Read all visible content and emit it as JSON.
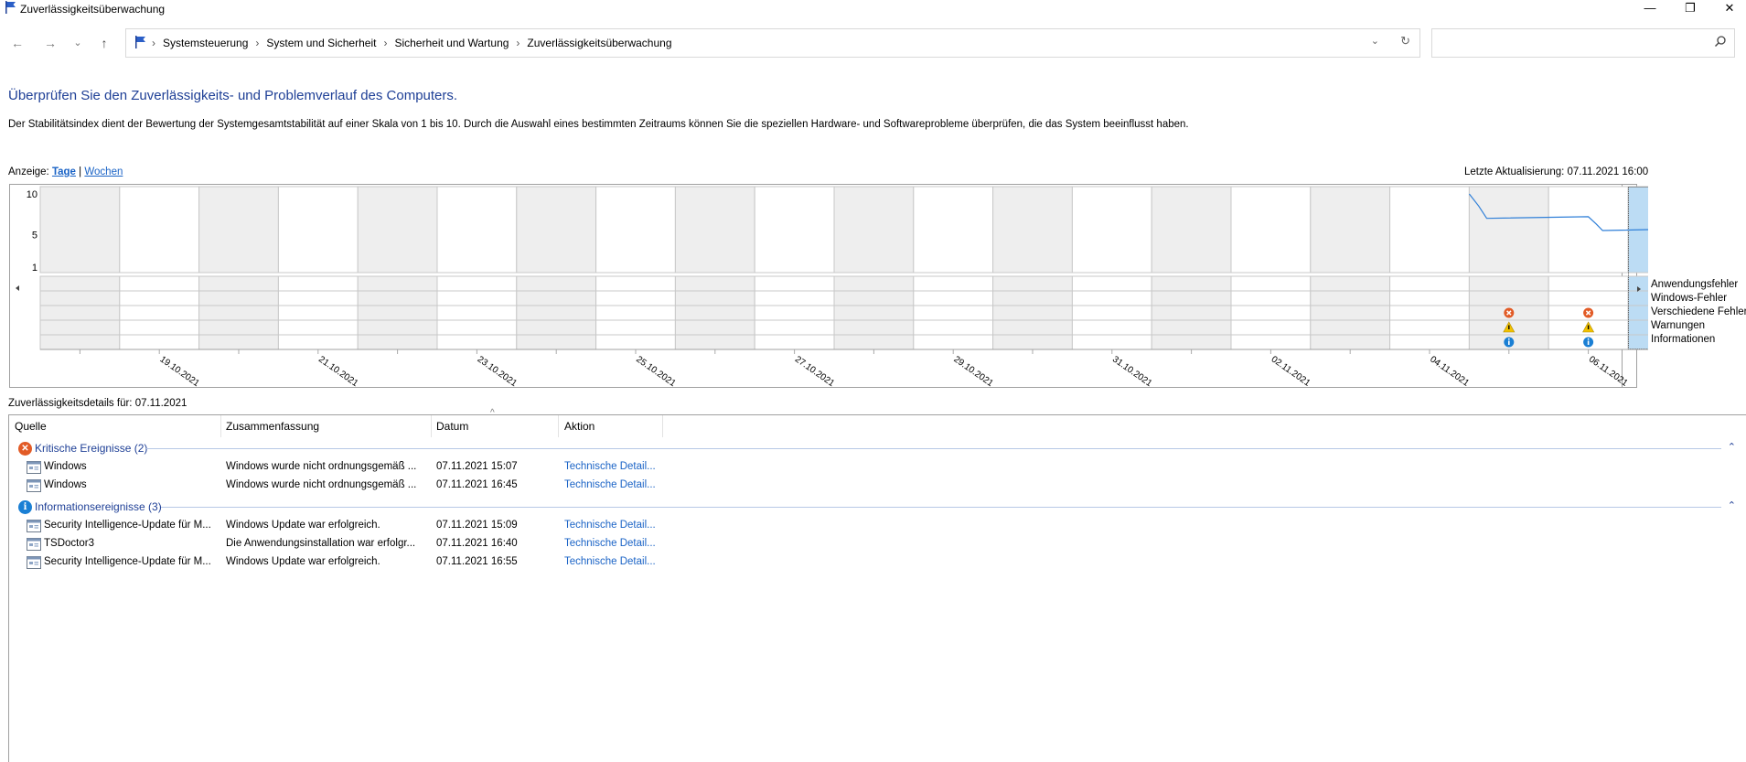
{
  "window": {
    "title": "Zuverlässigkeitsüberwachung",
    "minimize": "—",
    "maximize": "❐",
    "close": "✕"
  },
  "nav": {
    "back": "←",
    "forward": "→",
    "recent": "⌄",
    "up": "↑",
    "breadcrumb": [
      "Systemsteuerung",
      "System und Sicherheit",
      "Sicherheit und Wartung",
      "Zuverlässigkeitsüberwachung"
    ],
    "search_placeholder": ""
  },
  "header": {
    "heading": "Überprüfen Sie den Zuverlässigkeits- und Problemverlauf des Computers.",
    "description": "Der Stabilitätsindex dient der Bewertung der Systemgesamtstabilität auf einer Skala von 1 bis 10. Durch die Auswahl eines bestimmten Zeitraums können Sie die speziellen Hardware- und Softwareprobleme überprüfen, die das System beeinflusst haben.",
    "view_label": "Anzeige:",
    "view_days": "Tage",
    "view_sep": "|",
    "view_weeks": "Wochen",
    "last_update": "Letzte Aktualisierung: 07.11.2021 16:00"
  },
  "chart_data": {
    "type": "line",
    "y_ticks": [
      "10",
      "5",
      "1"
    ],
    "ylim": [
      1,
      10
    ],
    "x_tick_labels": [
      "19.10.2021",
      "21.10.2021",
      "23.10.2021",
      "25.10.2021",
      "27.10.2021",
      "29.10.2021",
      "31.10.2021",
      "02.11.2021",
      "04.11.2021",
      "06.11.2021"
    ],
    "days": [
      "18.10.2021",
      "19.10.2021",
      "20.10.2021",
      "21.10.2021",
      "22.10.2021",
      "23.10.2021",
      "24.10.2021",
      "25.10.2021",
      "26.10.2021",
      "27.10.2021",
      "28.10.2021",
      "29.10.2021",
      "30.10.2021",
      "31.10.2021",
      "01.11.2021",
      "02.11.2021",
      "03.11.2021",
      "04.11.2021",
      "05.11.2021",
      "06.11.2021",
      "07.11.2021"
    ],
    "selected_day": "07.11.2021",
    "stability_series": {
      "x": [
        "05.11.2021",
        "05.11.2021",
        "05.11.2021",
        "06.11.2021",
        "06.11.2021",
        "06.11.2021",
        "07.11.2021",
        "07.11.2021"
      ],
      "x_fraction_of_day": [
        0.0,
        0.12,
        0.22,
        0.5,
        0.6,
        0.68,
        0.75,
        0.98
      ],
      "y": [
        10.0,
        8.5,
        7.0,
        7.2,
        6.3,
        5.5,
        5.7,
        4.1
      ]
    },
    "event_rows": [
      "Anwendungsfehler",
      "Windows-Fehler",
      "Verschiedene Fehler",
      "Warnungen",
      "Informationen"
    ],
    "events": [
      {
        "day": "05.11.2021",
        "row": "Verschiedene Fehler",
        "kind": "error"
      },
      {
        "day": "05.11.2021",
        "row": "Warnungen",
        "kind": "warning"
      },
      {
        "day": "05.11.2021",
        "row": "Informationen",
        "kind": "info"
      },
      {
        "day": "06.11.2021",
        "row": "Verschiedene Fehler",
        "kind": "error"
      },
      {
        "day": "06.11.2021",
        "row": "Warnungen",
        "kind": "warning"
      },
      {
        "day": "06.11.2021",
        "row": "Informationen",
        "kind": "info"
      },
      {
        "day": "07.11.2021",
        "row": "Verschiedene Fehler",
        "kind": "error"
      },
      {
        "day": "07.11.2021",
        "row": "Informationen",
        "kind": "info"
      }
    ],
    "colors": {
      "line": "#2f7fd8",
      "selected_fill": "#bcdcf4",
      "shaded_day": "#eeeeee",
      "error": "#e25b26",
      "warning": "#f2c200",
      "info": "#1a7fd4"
    }
  },
  "details": {
    "title": "Zuverlässigkeitsdetails für: 07.11.2021",
    "columns": [
      "Quelle",
      "Zusammenfassung",
      "Datum",
      "Aktion"
    ],
    "sort_indicator": "^",
    "groups": [
      {
        "label": "Kritische Ereignisse (2)",
        "kind": "error",
        "rows": [
          {
            "source": "Windows",
            "summary": "Windows wurde nicht ordnungsgemäß ...",
            "date": "07.11.2021 15:07",
            "action": "Technische Detail..."
          },
          {
            "source": "Windows",
            "summary": "Windows wurde nicht ordnungsgemäß ...",
            "date": "07.11.2021 16:45",
            "action": "Technische Detail..."
          }
        ]
      },
      {
        "label": "Informationsereignisse (3)",
        "kind": "info",
        "rows": [
          {
            "source": "Security Intelligence-Update für M...",
            "summary": "Windows Update war erfolgreich.",
            "date": "07.11.2021 15:09",
            "action": "Technische Detail..."
          },
          {
            "source": "TSDoctor3",
            "summary": "Die Anwendungsinstallation war erfolgr...",
            "date": "07.11.2021 16:40",
            "action": "Technische Detail..."
          },
          {
            "source": "Security Intelligence-Update für M...",
            "summary": "Windows Update war erfolgreich.",
            "date": "07.11.2021 16:55",
            "action": "Technische Detail..."
          }
        ]
      }
    ]
  }
}
